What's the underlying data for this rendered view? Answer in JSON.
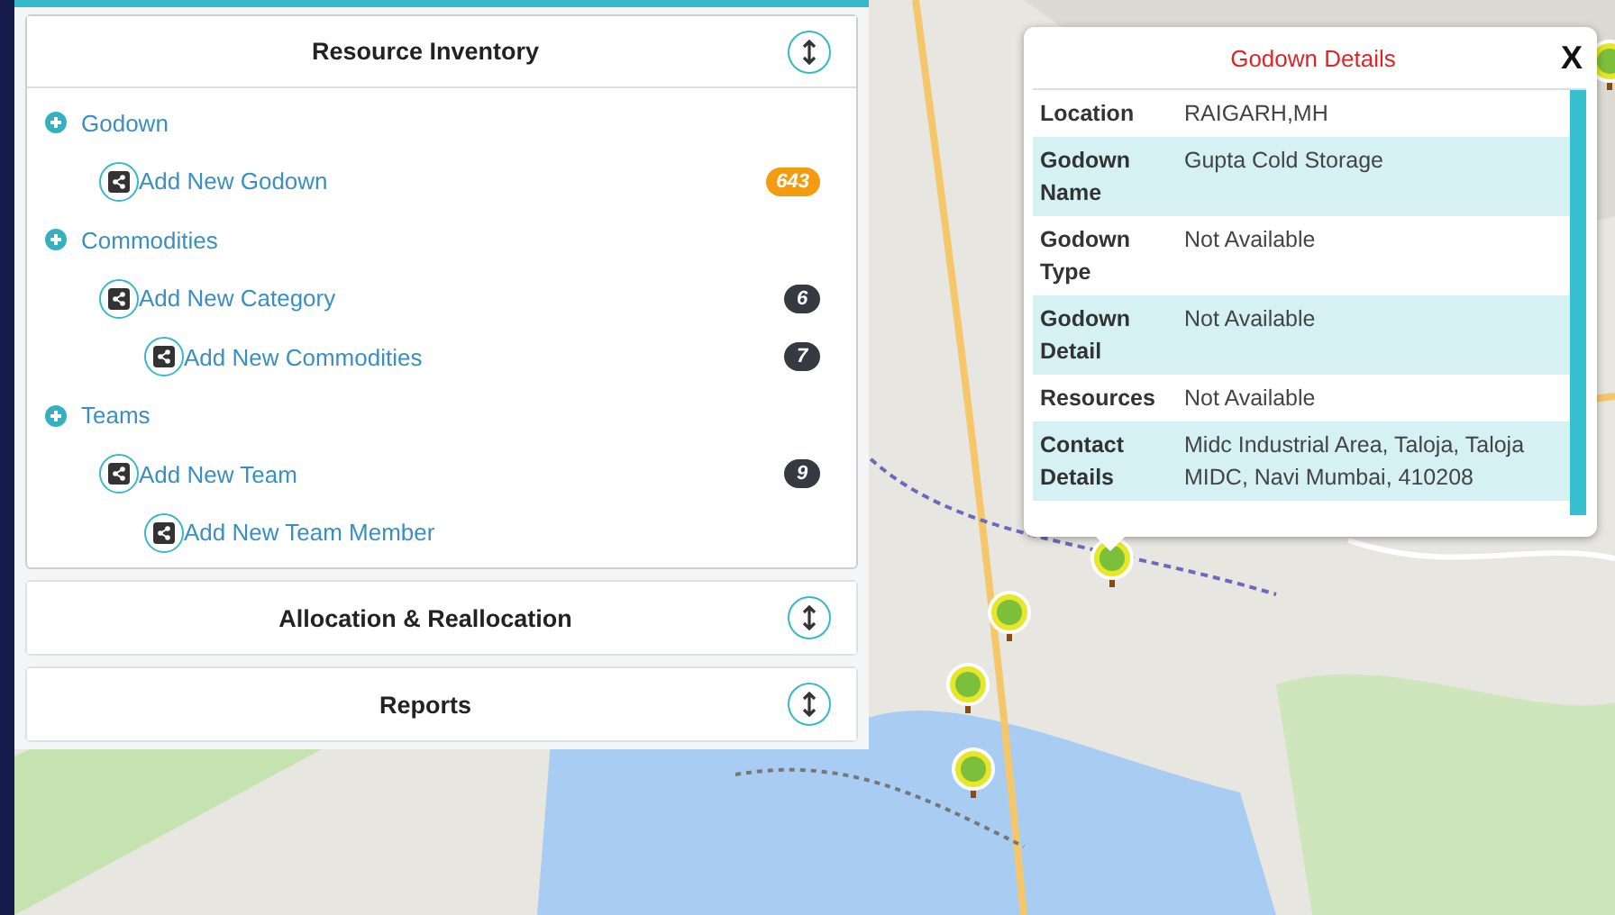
{
  "panel": {
    "sections": [
      {
        "title": "Resource Inventory",
        "expanded": true,
        "groups": [
          {
            "label": "Godown",
            "children": [
              {
                "label": "Add New Godown",
                "badge": "643",
                "color": "#f39c12"
              }
            ]
          },
          {
            "label": "Commodities",
            "children": [
              {
                "label": "Add New Category",
                "badge": "6",
                "color": "#343a40",
                "children": [
                  {
                    "label": "Add New Commodities",
                    "badge": "7",
                    "color": "#343a40"
                  }
                ]
              }
            ]
          },
          {
            "label": "Teams",
            "children": [
              {
                "label": "Add New Team",
                "badge": "9",
                "color": "#343a40",
                "children": [
                  {
                    "label": "Add New Team Member"
                  }
                ]
              }
            ]
          }
        ]
      },
      {
        "title": "Allocation & Reallocation",
        "expanded": false
      },
      {
        "title": "Reports",
        "expanded": false
      }
    ]
  },
  "popup": {
    "title": "Godown Details",
    "close": "X",
    "rows": [
      {
        "label": "Location",
        "value": "RAIGARH,MH"
      },
      {
        "label": "Godown Name",
        "value": "Gupta Cold Storage"
      },
      {
        "label": "Godown Type",
        "value": "Not Available"
      },
      {
        "label": "Godown Detail",
        "value": "Not Available"
      },
      {
        "label": "Resources",
        "value": "Not Available"
      },
      {
        "label": "Contact Details",
        "value": "Midc Industrial Area, Taloja, Taloja MIDC, Navi Mumbai, 410208"
      }
    ]
  }
}
